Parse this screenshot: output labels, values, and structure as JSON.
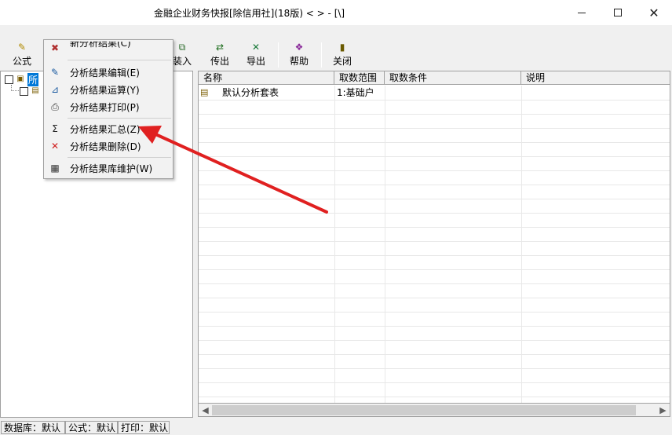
{
  "window": {
    "title": "金融企业财务快报[除信用社](18版) < > - [\\]",
    "min_label": "—",
    "max_label": "☐",
    "close_label": "✕"
  },
  "toolbar": {
    "formula": {
      "label": "公式",
      "icon": "formula-icon"
    },
    "load": {
      "label": "装入",
      "icon": "load-icon"
    },
    "transfer_out": {
      "label": "传出",
      "icon": "transfer-out-icon"
    },
    "export": {
      "label": "导出",
      "icon": "export-icon"
    },
    "help": {
      "label": "帮助",
      "icon": "help-book-icon"
    },
    "close": {
      "label": "关闭",
      "icon": "exit-door-icon"
    }
  },
  "tree": {
    "root_label": "所",
    "child_label": ""
  },
  "menu": {
    "items": [
      {
        "label": "新分析结果(C)",
        "icon": "new-result-icon"
      },
      {
        "label": "分析结果编辑(E)",
        "icon": "edit-icon"
      },
      {
        "label": "分析结果运算(Y)",
        "icon": "compute-icon"
      },
      {
        "label": "分析结果打印(P)",
        "icon": "printer-icon"
      },
      {
        "label": "分析结果汇总(Z)",
        "icon": "sigma-icon"
      },
      {
        "label": "分析结果删除(D)",
        "icon": "delete-x-icon"
      },
      {
        "label": "分析结果库维护(W)",
        "icon": "database-maintenance-icon"
      }
    ]
  },
  "grid": {
    "columns": [
      "名称",
      "取数范围",
      "取数条件",
      "说明"
    ],
    "rows": [
      {
        "name": "默认分析套表",
        "range": "1:基础户",
        "condition": "",
        "note": ""
      }
    ]
  },
  "statusbar": {
    "database": "数据库：默认",
    "formula": "公式：默认",
    "print": "打印：默认"
  },
  "colors": {
    "selection": "#0078d7",
    "annotation_arrow": "#e02020"
  }
}
